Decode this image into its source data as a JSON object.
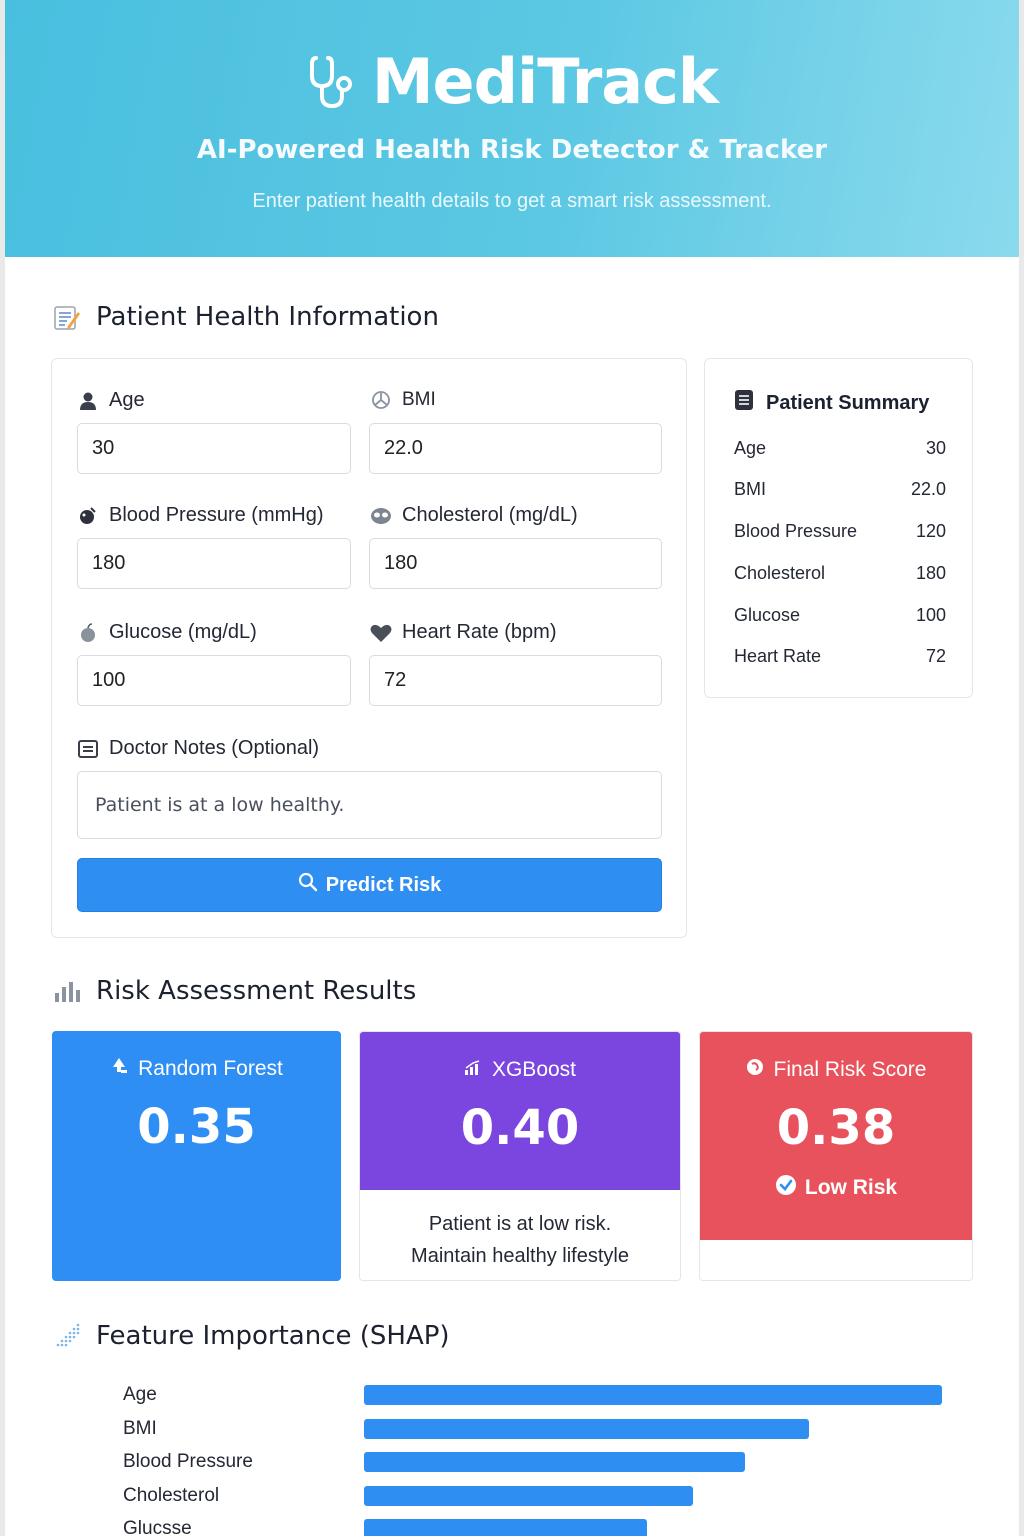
{
  "header": {
    "title": "MediTrack",
    "subtitle": "AI-Powered Health Risk Detector & Tracker",
    "tagline": "Enter patient health details to get a smart risk assessment.",
    "icon": "stethoscope-icon"
  },
  "form": {
    "section_title": "Patient Health Information",
    "fields": [
      {
        "label": "Age",
        "value": "30",
        "icon": "user-icon"
      },
      {
        "label": "BMI",
        "value": "22.0",
        "icon": "gauge-icon"
      },
      {
        "label": "Blood Pressure (mmHg)",
        "value": "180",
        "icon": "blood-drop-icon"
      },
      {
        "label": "Cholesterol (mg/dL)",
        "value": "180",
        "icon": "cholesterol-icon"
      },
      {
        "label": "Glucose (mg/dL)",
        "value": "100",
        "icon": "apple-icon"
      },
      {
        "label": "Heart Rate (bpm)",
        "value": "72",
        "icon": "heart-icon"
      }
    ],
    "notes_label": "Doctor Notes (Optional)",
    "notes_value": "Patient is at a low healthy.",
    "predict_label": "Predict Risk"
  },
  "summary": {
    "title": "Patient Summary",
    "rows": [
      {
        "label": "Age",
        "value": "30"
      },
      {
        "label": "BMI",
        "value": "22.0"
      },
      {
        "label": "Blood Pressure",
        "value": "120"
      },
      {
        "label": "Cholesterol",
        "value": "180"
      },
      {
        "label": "Glucose",
        "value": "100"
      },
      {
        "label": "Heart Rate",
        "value": "72"
      }
    ]
  },
  "results": {
    "section_title": "Risk Assessment Results",
    "random_forest": {
      "label": "Random Forest",
      "value": "0.35"
    },
    "xgboost": {
      "label": "XGBoost",
      "value": "0.40",
      "note_line1": "Patient is at low risk.",
      "note_line2": "Maintain healthy lifestyle"
    },
    "final": {
      "label": "Final Risk Score",
      "value": "0.38",
      "badge": "Low Risk"
    },
    "colors": {
      "random_forest": "#2e8ef3",
      "xgboost": "#7b45df",
      "final": "#e8525d"
    }
  },
  "shap": {
    "section_title": "Feature Importance (SHAP)"
  },
  "chart_data": {
    "type": "bar",
    "orientation": "horizontal",
    "title": "Feature Importance (SHAP)",
    "categories": [
      "Age",
      "BMI",
      "Blood Pressure",
      "Cholesterol",
      "Glucsse"
    ],
    "values": [
      1.0,
      0.77,
      0.66,
      0.57,
      0.49
    ],
    "color": "#2f8ef2"
  }
}
